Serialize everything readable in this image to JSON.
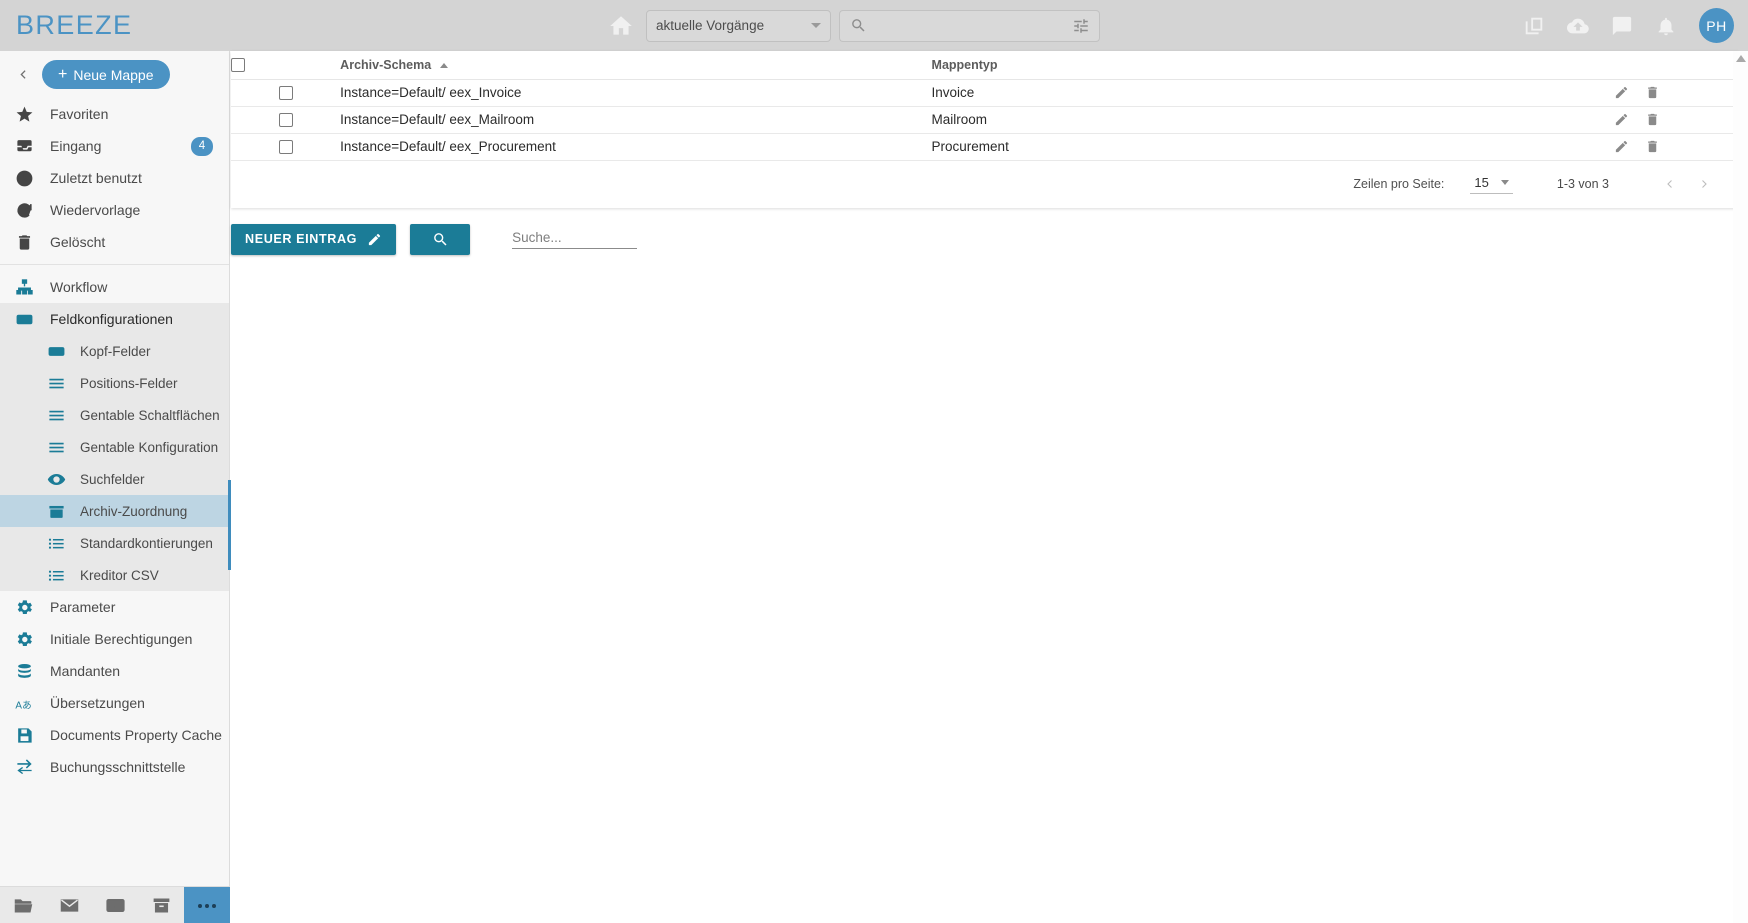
{
  "app": {
    "brand": "BREEZE"
  },
  "topbar": {
    "home_icon": "home-icon",
    "context_select": {
      "value": "aktuelle Vorgänge",
      "caret_icon": "chevron-down-icon"
    },
    "search": {
      "placeholder": "",
      "value": "",
      "search_icon": "search-icon",
      "filter_icon": "tune-filter-icon"
    },
    "icons": [
      {
        "name": "copy-windows-icon"
      },
      {
        "name": "cloud-upload-icon"
      },
      {
        "name": "chat-icon"
      },
      {
        "name": "bell-notification-icon"
      }
    ],
    "avatar": {
      "initials": "PH"
    }
  },
  "sidebar": {
    "collapse_label": "<",
    "new_folder_button": "Neue Mappe",
    "primary_items": [
      {
        "label": "Favoriten",
        "icon": "star-icon",
        "badge": null
      },
      {
        "label": "Eingang",
        "icon": "inbox-icon",
        "badge": "4"
      },
      {
        "label": "Zuletzt benutzt",
        "icon": "clock-icon",
        "badge": null
      },
      {
        "label": "Wiedervorlage",
        "icon": "refresh-icon",
        "badge": null
      },
      {
        "label": "Gelöscht",
        "icon": "trash-icon",
        "badge": null
      }
    ],
    "workflow": {
      "label": "Workflow",
      "icon": "sitemap-icon"
    },
    "group": {
      "label": "Feldkonfigurationen",
      "icon": "rectangle-icon",
      "children": [
        {
          "label": "Kopf-Felder",
          "icon": "rectangle-icon",
          "active": false
        },
        {
          "label": "Positions-Felder",
          "icon": "list-lines-icon",
          "active": false
        },
        {
          "label": "Gentable Schaltflächen",
          "icon": "list-lines-icon",
          "active": false
        },
        {
          "label": "Gentable Konfiguration",
          "icon": "list-lines-icon",
          "active": false
        },
        {
          "label": "Suchfelder",
          "icon": "eye-icon",
          "active": false
        },
        {
          "label": "Archiv-Zuordnung",
          "icon": "archive-box-icon",
          "active": true
        },
        {
          "label": "Standardkontierungen",
          "icon": "list-bullets-icon",
          "active": false
        },
        {
          "label": "Kreditor CSV",
          "icon": "list-bullets-icon",
          "active": false
        }
      ]
    },
    "tail_items": [
      {
        "label": "Parameter",
        "icon": "gear-icon"
      },
      {
        "label": "Initiale Berechtigungen",
        "icon": "gear-icon"
      },
      {
        "label": "Mandanten",
        "icon": "database-icon"
      },
      {
        "label": "Übersetzungen",
        "icon": "translate-icon"
      },
      {
        "label": "Documents Property Cache",
        "icon": "save-disk-icon"
      },
      {
        "label": "Buchungsschnittstelle",
        "icon": "exchange-arrows-icon"
      }
    ],
    "bottom_toolbar": [
      {
        "name": "folder-open-icon",
        "active": false
      },
      {
        "name": "mail-icon",
        "active": false
      },
      {
        "name": "card-icon",
        "active": false
      },
      {
        "name": "archive-icon",
        "active": false
      },
      {
        "name": "more-dots-icon",
        "active": true
      }
    ]
  },
  "table": {
    "columns": [
      {
        "key": "checkbox",
        "label": ""
      },
      {
        "key": "schema",
        "label": "Archiv-Schema",
        "sorted": "asc"
      },
      {
        "key": "mappentyp",
        "label": "Mappentyp"
      },
      {
        "key": "actions",
        "label": ""
      }
    ],
    "rows": [
      {
        "schema": "Instance=Default/ eex_Invoice",
        "mappentyp": "Invoice",
        "edit_icon": "pencil-edit-icon",
        "delete_icon": "trash-delete-icon"
      },
      {
        "schema": "Instance=Default/ eex_Mailroom",
        "mappentyp": "Mailroom",
        "edit_icon": "pencil-edit-icon",
        "delete_icon": "trash-delete-icon"
      },
      {
        "schema": "Instance=Default/ eex_Procurement",
        "mappentyp": "Procurement",
        "edit_icon": "pencil-edit-icon",
        "delete_icon": "trash-delete-icon"
      }
    ]
  },
  "pagination": {
    "rows_per_page_label": "Zeilen pro Seite:",
    "rows_per_page_value": "15",
    "range_label": "1-3 von 3",
    "prev_icon": "chevron-left-icon",
    "next_icon": "chevron-right-icon"
  },
  "actionbar": {
    "new_entry_label": "NEUER EINTRAG",
    "new_entry_icon": "pencil-edit-icon",
    "search_button_icon": "search-icon",
    "search_placeholder": "Suche...",
    "search_value": ""
  },
  "colors": {
    "brand_blue": "#4b93c4",
    "teal": "#1b7c97",
    "topbar_bg": "#d4d4d4",
    "active_row": "#bdd5e3",
    "badge": "#4b93c4"
  }
}
